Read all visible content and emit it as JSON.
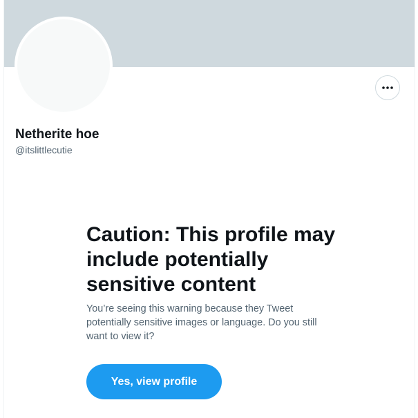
{
  "profile": {
    "display_name": "Netherite hoe",
    "handle": "@itslittlecutie"
  },
  "warning": {
    "title": "Caution: This profile may include potentially sensitive content",
    "body": "You’re seeing this warning because they Tweet potentially sensitive images or language. Do you still want to view it?",
    "view_button_label": "Yes, view profile"
  },
  "icons": {
    "more": "more-horizontal-icon"
  },
  "colors": {
    "banner": "#cfd9de",
    "accent": "#1d9bf0",
    "text_primary": "#0f1419",
    "text_secondary": "#536471"
  }
}
